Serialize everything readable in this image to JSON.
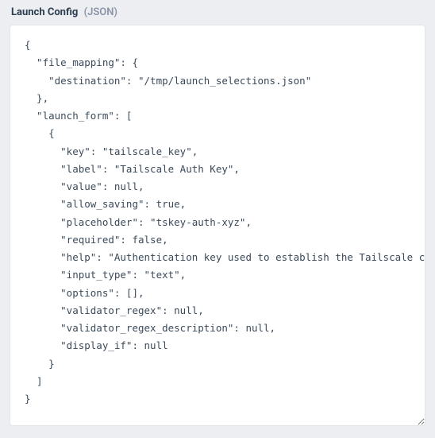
{
  "header": {
    "title": "Launch Config",
    "subtitle": "(JSON)"
  },
  "config_json": {
    "file_mapping": {
      "destination": "/tmp/launch_selections.json"
    },
    "launch_form": [
      {
        "key": "tailscale_key",
        "label": "Tailscale Auth Key",
        "value": null,
        "allow_saving": true,
        "placeholder": "tskey-auth-xyz",
        "required": false,
        "help": "Authentication key used to establish the Tailscale connection",
        "input_type": "text",
        "options": [],
        "validator_regex": null,
        "validator_regex_description": null,
        "display_if": null
      }
    ]
  }
}
